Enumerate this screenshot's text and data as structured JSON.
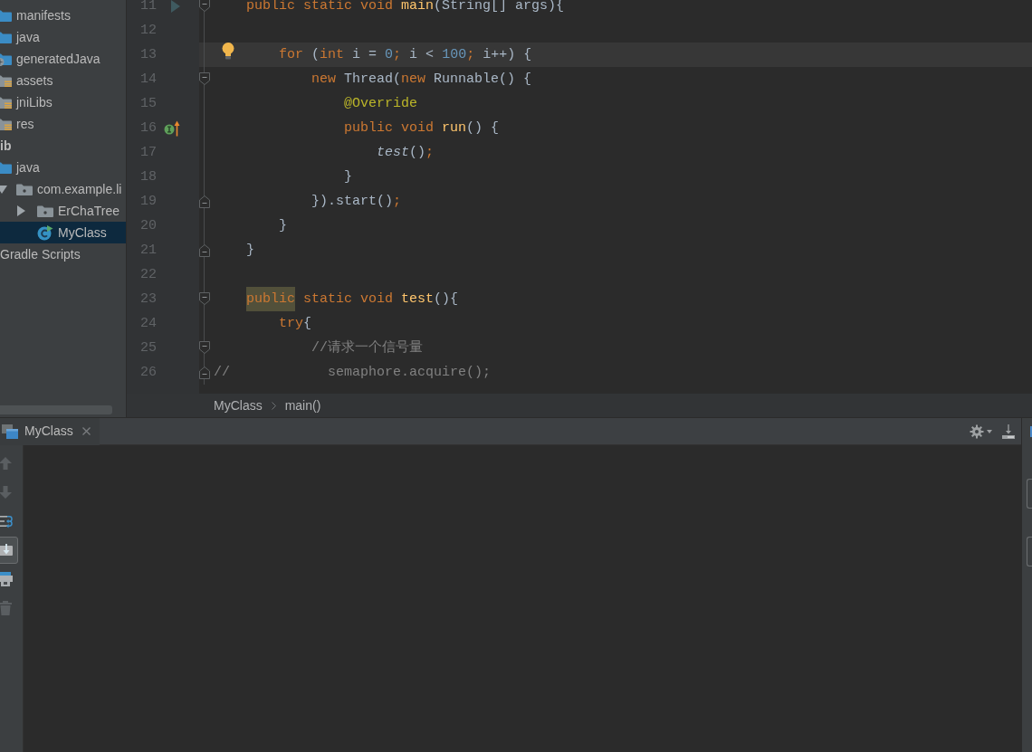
{
  "sidebar": {
    "tree": [
      {
        "children": [
          {
            "label": "manifests",
            "kind": "source",
            "selected": false
          },
          {
            "label": "java",
            "kind": "source",
            "selected": false
          },
          {
            "label": "generatedJava",
            "kind": "generated",
            "selected": false
          },
          {
            "label": "assets",
            "kind": "resources",
            "selected": false
          },
          {
            "label": "jniLibs",
            "kind": "resources",
            "selected": false
          },
          {
            "label": "res",
            "kind": "resources",
            "selected": false
          }
        ]
      },
      {
        "label": "ib",
        "kind": "module",
        "selected": false,
        "children": [
          {
            "label": "java",
            "kind": "source",
            "selected": false,
            "children": [
              {
                "label": "com.example.li",
                "kind": "package",
                "selected": false,
                "expanded": true,
                "children": [
                  {
                    "label": "ErChaTree",
                    "kind": "package",
                    "selected": false,
                    "expanded": false
                  },
                  {
                    "label": "MyClass",
                    "kind": "class",
                    "selected": true
                  }
                ]
              }
            ]
          }
        ]
      },
      {
        "label": "Gradle Scripts",
        "kind": "scripts",
        "selected": false
      }
    ]
  },
  "editor": {
    "lines": [
      {
        "number": "11",
        "current": false,
        "marker": {
          "kind": "run"
        },
        "fold": {
          "kind": "start"
        },
        "tokens": [
          {
            "kind": "keyword",
            "text": "    public static void "
          },
          {
            "kind": "method",
            "text": "main"
          },
          {
            "kind": "plain",
            "text": "(String[] args){"
          }
        ]
      },
      {
        "number": "12",
        "current": false
      },
      {
        "number": "13",
        "current": true,
        "marker": {
          "kind": "bulb"
        },
        "tokens": [
          {
            "kind": "keyword",
            "text": "        for "
          },
          {
            "kind": "plain",
            "text": "("
          },
          {
            "kind": "keyword",
            "text": "int"
          },
          {
            "kind": "plain",
            "text": " i = "
          },
          {
            "kind": "number",
            "text": "0"
          },
          {
            "kind": "keyword",
            "text": ";"
          },
          {
            "kind": "plain",
            "text": " i < "
          },
          {
            "kind": "number",
            "text": "100"
          },
          {
            "kind": "keyword",
            "text": ";"
          },
          {
            "kind": "plain",
            "text": " i++) {"
          }
        ]
      },
      {
        "number": "14",
        "current": false,
        "fold": {
          "kind": "start"
        },
        "tokens": [
          {
            "kind": "keyword",
            "text": "            new "
          },
          {
            "kind": "plain",
            "text": "Thread("
          },
          {
            "kind": "keyword",
            "text": "new "
          },
          {
            "kind": "plain",
            "text": "Runnable() {"
          }
        ]
      },
      {
        "number": "15",
        "current": false,
        "tokens": [
          {
            "kind": "annotation",
            "text": "                @Override"
          }
        ]
      },
      {
        "number": "16",
        "current": false,
        "marker": {
          "kind": "override"
        },
        "tokens": [
          {
            "kind": "keyword",
            "text": "                public void "
          },
          {
            "kind": "method",
            "text": "run"
          },
          {
            "kind": "plain",
            "text": "() {"
          }
        ]
      },
      {
        "number": "17",
        "current": false,
        "tokens": [
          {
            "kind": "call",
            "text": "                    test"
          },
          {
            "kind": "plain",
            "text": "()"
          },
          {
            "kind": "keyword",
            "text": ";"
          }
        ]
      },
      {
        "number": "18",
        "current": false,
        "tokens": [
          {
            "kind": "plain",
            "text": "                }"
          }
        ]
      },
      {
        "number": "19",
        "current": false,
        "fold": {
          "kind": "end"
        },
        "tokens": [
          {
            "kind": "plain",
            "text": "            }).start()"
          },
          {
            "kind": "keyword",
            "text": ";"
          }
        ]
      },
      {
        "number": "20",
        "current": false,
        "tokens": [
          {
            "kind": "plain",
            "text": "        }"
          }
        ]
      },
      {
        "number": "21",
        "current": false,
        "fold": {
          "kind": "end"
        },
        "tokens": [
          {
            "kind": "plain",
            "text": "    }"
          }
        ]
      },
      {
        "number": "22",
        "current": false
      },
      {
        "number": "23",
        "current": false,
        "fold": {
          "kind": "start"
        },
        "tokens": [
          {
            "kind": "highlight",
            "text": "    public"
          },
          {
            "kind": "keyword",
            "text": " static void "
          },
          {
            "kind": "method",
            "text": "test"
          },
          {
            "kind": "plain",
            "text": "(){"
          }
        ]
      },
      {
        "number": "24",
        "current": false,
        "tokens": [
          {
            "kind": "keyword",
            "text": "        try"
          },
          {
            "kind": "plain",
            "text": "{"
          }
        ]
      },
      {
        "number": "25",
        "current": false,
        "fold": {
          "kind": "start"
        },
        "tokens": [
          {
            "kind": "comment",
            "text": "            //请求一个信号量"
          }
        ]
      },
      {
        "number": "26",
        "current": false,
        "fold": {
          "kind": "end"
        },
        "tokens": [
          {
            "kind": "comment",
            "text": "//            semaphore.acquire();"
          }
        ]
      }
    ]
  },
  "breadcrumbs": [
    "MyClass",
    "main()"
  ],
  "run_panel": {
    "tabs": [
      {
        "label": "MyClass",
        "selected": true
      }
    ],
    "tools": [
      {
        "kind": "up",
        "disabled": true,
        "on": false
      },
      {
        "kind": "down",
        "disabled": true,
        "on": false
      },
      {
        "kind": "wrap",
        "disabled": false,
        "on": false
      },
      {
        "kind": "scroll",
        "disabled": false,
        "on": true
      },
      {
        "kind": "print",
        "disabled": false,
        "on": false
      },
      {
        "kind": "clear",
        "disabled": true,
        "on": false
      }
    ]
  }
}
